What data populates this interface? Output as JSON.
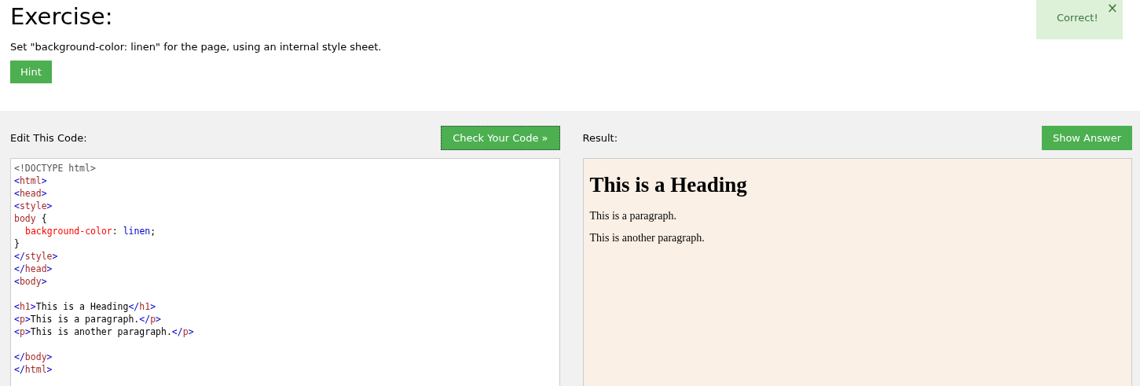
{
  "exercise": {
    "title": "Exercise:",
    "instruction": "Set \"background-color: linen\" for the page, using an internal style sheet.",
    "hint_button": "Hint"
  },
  "notification": {
    "message": "Correct!",
    "close": "×"
  },
  "editor": {
    "label": "Edit This Code:",
    "button": "Check Your Code »",
    "lines": [
      [
        {
          "kind": "doctype",
          "text": "<!DOCTYPE html>"
        }
      ],
      [
        {
          "kind": "punct",
          "text": "<"
        },
        {
          "kind": "tag",
          "text": "html"
        },
        {
          "kind": "punct",
          "text": ">"
        }
      ],
      [
        {
          "kind": "punct",
          "text": "<"
        },
        {
          "kind": "tag",
          "text": "head"
        },
        {
          "kind": "punct",
          "text": ">"
        }
      ],
      [
        {
          "kind": "punct",
          "text": "<"
        },
        {
          "kind": "tag",
          "text": "style"
        },
        {
          "kind": "punct",
          "text": ">"
        }
      ],
      [
        {
          "kind": "tag",
          "text": "body"
        },
        {
          "kind": "text",
          "text": " {"
        }
      ],
      {
        "indented": true,
        "tokens": [
          {
            "kind": "prop",
            "text": "background-color"
          },
          {
            "kind": "text",
            "text": ": "
          },
          {
            "kind": "value",
            "text": "linen"
          },
          {
            "kind": "text",
            "text": ";"
          }
        ]
      },
      [
        {
          "kind": "text",
          "text": "}"
        }
      ],
      [
        {
          "kind": "punct",
          "text": "</"
        },
        {
          "kind": "tag",
          "text": "style"
        },
        {
          "kind": "punct",
          "text": ">"
        }
      ],
      [
        {
          "kind": "punct",
          "text": "</"
        },
        {
          "kind": "tag",
          "text": "head"
        },
        {
          "kind": "punct",
          "text": ">"
        }
      ],
      [
        {
          "kind": "punct",
          "text": "<"
        },
        {
          "kind": "tag",
          "text": "body"
        },
        {
          "kind": "punct",
          "text": ">"
        }
      ],
      {
        "blank": true
      },
      [
        {
          "kind": "punct",
          "text": "<"
        },
        {
          "kind": "tag",
          "text": "h1"
        },
        {
          "kind": "punct",
          "text": ">"
        },
        {
          "kind": "text",
          "text": "This is a Heading"
        },
        {
          "kind": "punct",
          "text": "</"
        },
        {
          "kind": "tag",
          "text": "h1"
        },
        {
          "kind": "punct",
          "text": ">"
        }
      ],
      [
        {
          "kind": "punct",
          "text": "<"
        },
        {
          "kind": "tag",
          "text": "p"
        },
        {
          "kind": "punct",
          "text": ">"
        },
        {
          "kind": "text",
          "text": "This is a paragraph."
        },
        {
          "kind": "punct",
          "text": "</"
        },
        {
          "kind": "tag",
          "text": "p"
        },
        {
          "kind": "punct",
          "text": ">"
        }
      ],
      [
        {
          "kind": "punct",
          "text": "<"
        },
        {
          "kind": "tag",
          "text": "p"
        },
        {
          "kind": "punct",
          "text": ">"
        },
        {
          "kind": "text",
          "text": "This is another paragraph."
        },
        {
          "kind": "punct",
          "text": "</"
        },
        {
          "kind": "tag",
          "text": "p"
        },
        {
          "kind": "punct",
          "text": ">"
        }
      ],
      {
        "blank": true
      },
      [
        {
          "kind": "punct",
          "text": "</"
        },
        {
          "kind": "tag",
          "text": "body"
        },
        {
          "kind": "punct",
          "text": ">"
        }
      ],
      [
        {
          "kind": "punct",
          "text": "</"
        },
        {
          "kind": "tag",
          "text": "html"
        },
        {
          "kind": "punct",
          "text": ">"
        }
      ]
    ]
  },
  "result": {
    "label": "Result:",
    "button": "Show Answer",
    "heading": "This is a Heading",
    "paragraphs": [
      "This is a paragraph.",
      "This is another paragraph."
    ]
  }
}
